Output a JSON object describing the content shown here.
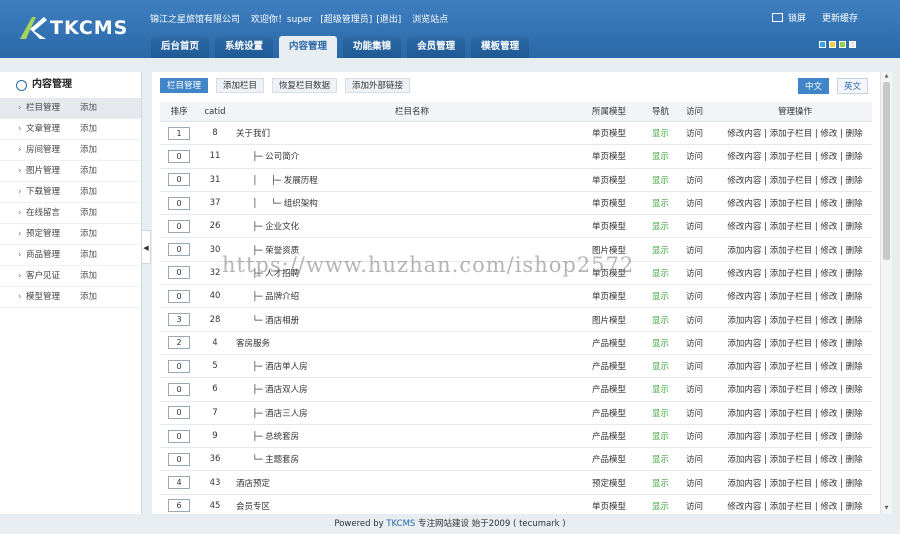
{
  "app": {
    "logo_text": "TKCMS",
    "company": "锦江之星旅馆有限公司",
    "welcome": "欢迎你！super",
    "role": "[超级管理员]",
    "logout": "[退出]",
    "browse": "浏览站点",
    "lock": "锁屏",
    "refresh_cache": "更新缓存"
  },
  "nav": {
    "tabs": [
      "后台首页",
      "系统设置",
      "内容管理",
      "功能集锦",
      "会员管理",
      "模板管理"
    ],
    "active_index": 2
  },
  "skins": [
    "#3aa0e8",
    "#f0d040",
    "#9ad048",
    "#e8e8e8"
  ],
  "sidebar": {
    "title": "内容管理",
    "add_label": "添加",
    "items": [
      "栏目管理",
      "文章管理",
      "房间管理",
      "图片管理",
      "下载管理",
      "在线留言",
      "预定管理",
      "商品管理",
      "客户见证",
      "模型管理"
    ],
    "active_index": 0
  },
  "toolbar": {
    "buttons": [
      "栏目管理",
      "添加栏目",
      "恢复栏目数据",
      "添加外部链接"
    ],
    "active_index": 0
  },
  "langs": [
    "中文",
    "英文"
  ],
  "table": {
    "headers": [
      "排序",
      "catid",
      "栏目名称",
      "所属模型",
      "导航",
      "访问",
      "管理操作"
    ],
    "show_label": "显示",
    "visit_label": "访问",
    "ops_label": "修改内容 | 添加子栏目 | 修改 | 删除",
    "ops_label_alt": "添加内容 | 添加子栏目 | 修改 | 删除",
    "rows": [
      {
        "sort": "1",
        "catid": "8",
        "name": "关于我们",
        "model": "单页模型",
        "ops": "修改内容 | 添加子栏目 | 修改 | 删除"
      },
      {
        "sort": "0",
        "catid": "11",
        "name": "      ├─ 公司简介",
        "model": "单页模型",
        "ops": "修改内容 | 添加子栏目 | 修改 | 删除"
      },
      {
        "sort": "0",
        "catid": "31",
        "name": "      │     ├─ 发展历程",
        "model": "单页模型",
        "ops": "修改内容 | 添加子栏目 | 修改 | 删除"
      },
      {
        "sort": "0",
        "catid": "37",
        "name": "      │     └─ 组织架构",
        "model": "单页模型",
        "ops": "修改内容 | 添加子栏目 | 修改 | 删除"
      },
      {
        "sort": "0",
        "catid": "26",
        "name": "      ├─ 企业文化",
        "model": "单页模型",
        "ops": "修改内容 | 添加子栏目 | 修改 | 删除"
      },
      {
        "sort": "0",
        "catid": "30",
        "name": "      ├─ 荣誉资质",
        "model": "图片模型",
        "ops": "添加内容 | 添加子栏目 | 修改 | 删除"
      },
      {
        "sort": "0",
        "catid": "32",
        "name": "      ├─ 人才招聘",
        "model": "单页模型",
        "ops": "修改内容 | 添加子栏目 | 修改 | 删除"
      },
      {
        "sort": "0",
        "catid": "40",
        "name": "      ├─ 品牌介绍",
        "model": "单页模型",
        "ops": "修改内容 | 添加子栏目 | 修改 | 删除"
      },
      {
        "sort": "3",
        "catid": "28",
        "name": "      └─ 酒店相册",
        "model": "图片模型",
        "ops": "添加内容 | 添加子栏目 | 修改 | 删除"
      },
      {
        "sort": "2",
        "catid": "4",
        "name": "客房服务",
        "model": "产品模型",
        "ops": "添加内容 | 添加子栏目 | 修改 | 删除"
      },
      {
        "sort": "0",
        "catid": "5",
        "name": "      ├─ 酒店单人房",
        "model": "产品模型",
        "ops": "添加内容 | 添加子栏目 | 修改 | 删除"
      },
      {
        "sort": "0",
        "catid": "6",
        "name": "      ├─ 酒店双人房",
        "model": "产品模型",
        "ops": "添加内容 | 添加子栏目 | 修改 | 删除"
      },
      {
        "sort": "0",
        "catid": "7",
        "name": "      ├─ 酒店三人房",
        "model": "产品模型",
        "ops": "添加内容 | 添加子栏目 | 修改 | 删除"
      },
      {
        "sort": "0",
        "catid": "9",
        "name": "      ├─ 总统套房",
        "model": "产品模型",
        "ops": "添加内容 | 添加子栏目 | 修改 | 删除"
      },
      {
        "sort": "0",
        "catid": "36",
        "name": "      └─ 主题套房",
        "model": "产品模型",
        "ops": "添加内容 | 添加子栏目 | 修改 | 删除"
      },
      {
        "sort": "4",
        "catid": "43",
        "name": "酒店预定",
        "model": "预定模型",
        "ops": "添加内容 | 添加子栏目 | 修改 | 删除"
      },
      {
        "sort": "6",
        "catid": "45",
        "name": "会员专区",
        "model": "单页模型",
        "ops": "修改内容 | 添加子栏目 | 修改 | 删除"
      }
    ]
  },
  "footer": {
    "prefix": "Powered by",
    "brand": "TKCMS",
    "suffix": "专注网站建设  始于2009 ( tecumark )"
  },
  "watermark": "https://www.huzhan.com/ishop2572"
}
